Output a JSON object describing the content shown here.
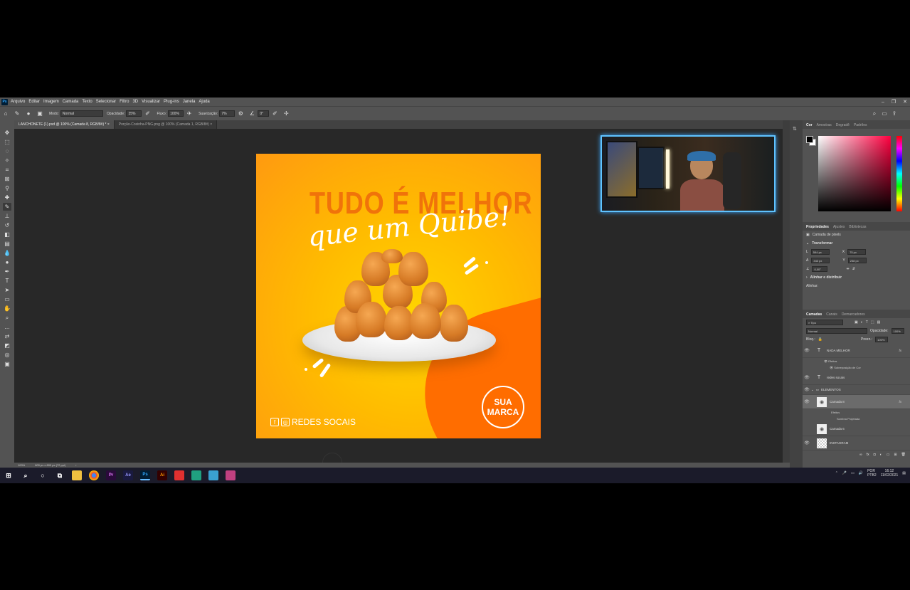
{
  "menubar": {
    "items": [
      "Arquivo",
      "Editar",
      "Imagem",
      "Camada",
      "Texto",
      "Selecionar",
      "Filtro",
      "3D",
      "Visualizar",
      "Plug-ins",
      "Janela",
      "Ajuda"
    ]
  },
  "options": {
    "mode_label": "Modo:",
    "mode_value": "Normal",
    "opacity_label": "Opacidade:",
    "opacity_value": "35%",
    "flow_label": "Fluxo:",
    "flow_value": "100%",
    "smoothing_label": "Suavização:",
    "smoothing_value": "7%",
    "angle_value": "0°"
  },
  "tabs": [
    {
      "label": "LANCHONETE (1).psd @ 100% (Camada 8, RGB/8#) *"
    },
    {
      "label": "Porção-Coxinha-PNG.png @ 100% (Camada 1, RGB/8#)"
    }
  ],
  "artwork": {
    "headline": "TUDO É MELHOR",
    "script": "que um Quibe!",
    "brand_line1": "SUA",
    "brand_line2": "MARCA",
    "social_text": "REDES SOCAIS",
    "social_fb_icon": "f",
    "social_ig_icon": "◎"
  },
  "status": {
    "zoom": "100%",
    "size": "800 px x 800 px (72 ppi)"
  },
  "color_panel": {
    "tabs": [
      "Cor",
      "Amostras",
      "Degradê",
      "Padrões"
    ]
  },
  "properties": {
    "tabs": [
      "Propriedades",
      "Ajustes",
      "Bibliotecas"
    ],
    "layer_kind": "Camada de pixels",
    "transform_label": "Transformar",
    "w_label": "L",
    "w_value": "594 px",
    "x_label": "X",
    "x_value": "75 px",
    "h_label": "A",
    "h_value": "343 px",
    "y_label": "Y",
    "y_value": "238 px",
    "angle_value": "0,00°",
    "align_label": "Alinhar e distribuir",
    "align_sub": "Alinhar:"
  },
  "layers": {
    "tabs": [
      "Camadas",
      "Canais",
      "Demarcadores"
    ],
    "filter_kind": "Tipo",
    "blend": "Normal",
    "opacity_label": "Opacidade:",
    "opacity_value": "100%",
    "lock_label": "Bloq.:",
    "fill_label": "Preen.:",
    "fill_value": "100%",
    "items": [
      {
        "name": "NADA MELHOR",
        "kind": "T",
        "fx": "fx",
        "effects_label": "Efeitos",
        "effect": "Sobreposição de Cor"
      },
      {
        "name": "redes socais",
        "kind": "T"
      },
      {
        "name": "ELEMENTOS",
        "kind": "folder"
      },
      {
        "name": "Camada 8",
        "kind": "img",
        "fx": "fx",
        "effects_label": "Efeitos",
        "effect": "Sombra Projetada"
      },
      {
        "name": "Camada 6",
        "kind": "img"
      },
      {
        "name": "INSTAGRAM",
        "kind": "checker"
      }
    ]
  },
  "tray": {
    "lang1": "POR",
    "lang2": "PTB2",
    "time": "16:12",
    "date": "11/02/2021"
  },
  "taskbar": {
    "apps": [
      "Pr",
      "Ae",
      "Ps",
      "Ai"
    ]
  }
}
